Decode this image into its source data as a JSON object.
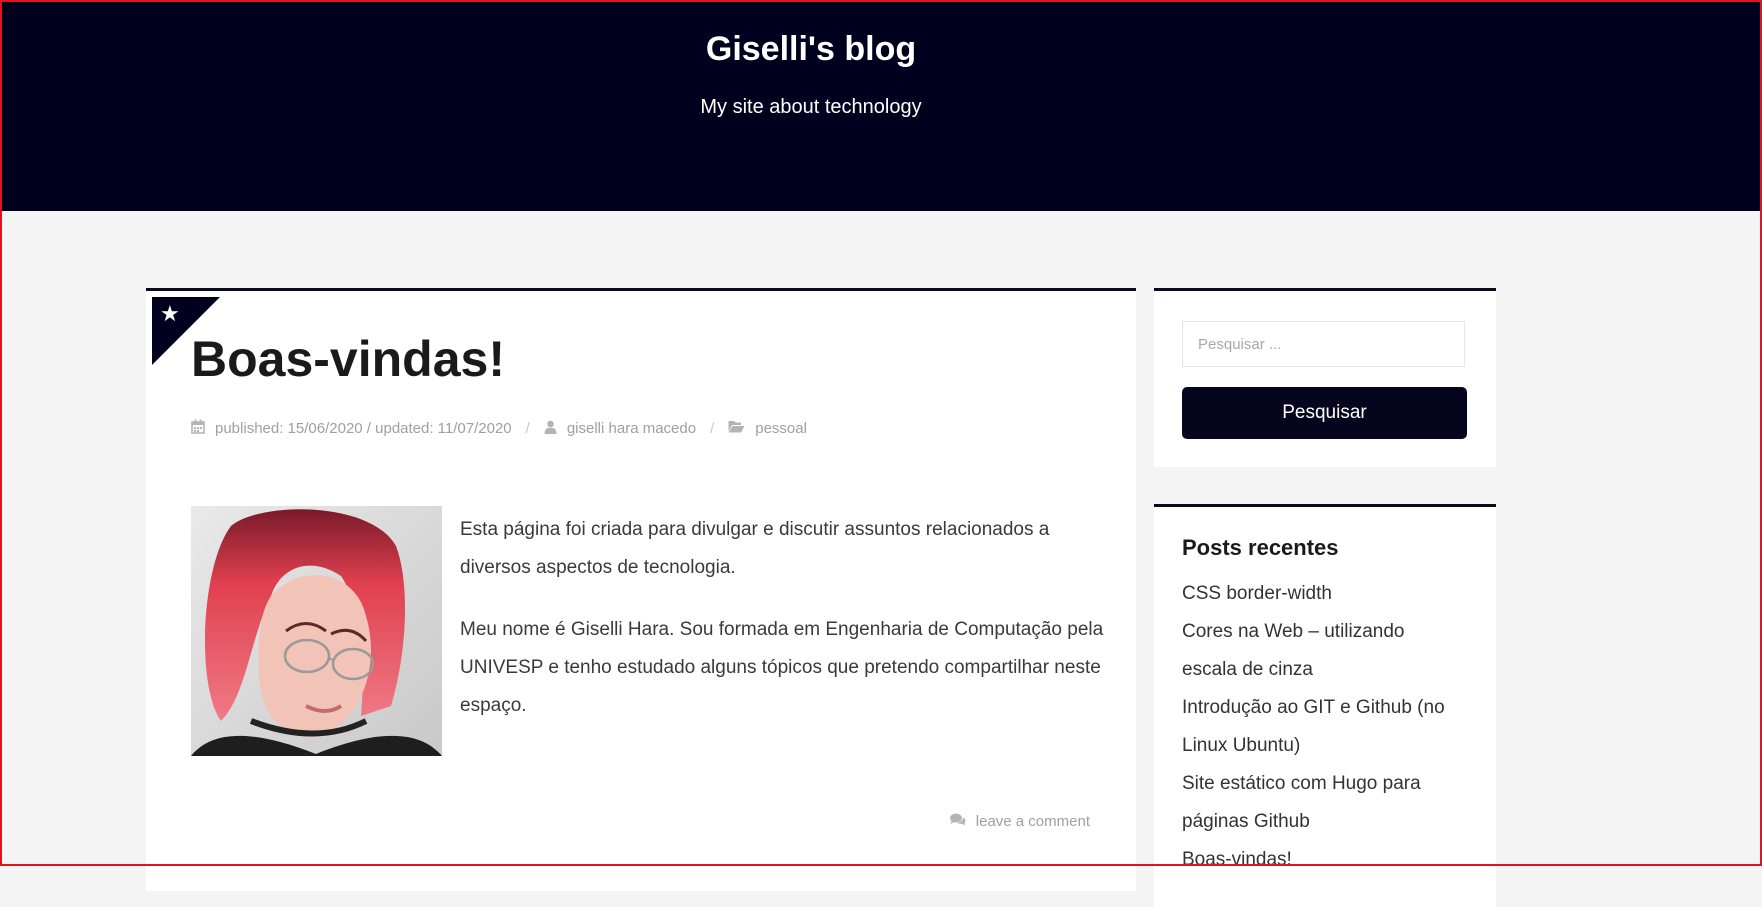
{
  "header": {
    "site_title": "Giselli's blog",
    "site_description": "My site about technology",
    "background_color": "#00001e"
  },
  "post": {
    "title": "Boas-vindas!",
    "featured_icon": "star-icon",
    "meta": {
      "date_icon": "calendar-icon",
      "date_text": "published: 15/06/2020 / updated: 11/07/2020",
      "author_icon": "user-icon",
      "author": "giselli hara macedo",
      "category_icon": "folder-open-icon",
      "category": "pessoal"
    },
    "image_alt": "photo of Giselli Hara",
    "paragraphs": [
      "Esta página foi criada para divulgar e discutir assuntos relacionados a diversos aspectos de tecnologia.",
      "Meu nome é Giselli Hara. Sou formada em Engenharia de Computação pela UNIVESP e tenho estudado alguns tópicos que pretendo compartilhar neste espaço."
    ],
    "comment_icon": "comments-icon",
    "comment_link": "leave a comment"
  },
  "sidebar": {
    "search": {
      "placeholder": "Pesquisar ...",
      "button_label": "Pesquisar"
    },
    "recent_posts": {
      "title": "Posts recentes",
      "items": [
        "CSS border-width",
        "Cores na Web – utilizando escala de cinza",
        "Introdução ao GIT e Github (no Linux Ubuntu)",
        "Site estático com Hugo para páginas Github",
        "Boas-vindas!"
      ]
    }
  }
}
